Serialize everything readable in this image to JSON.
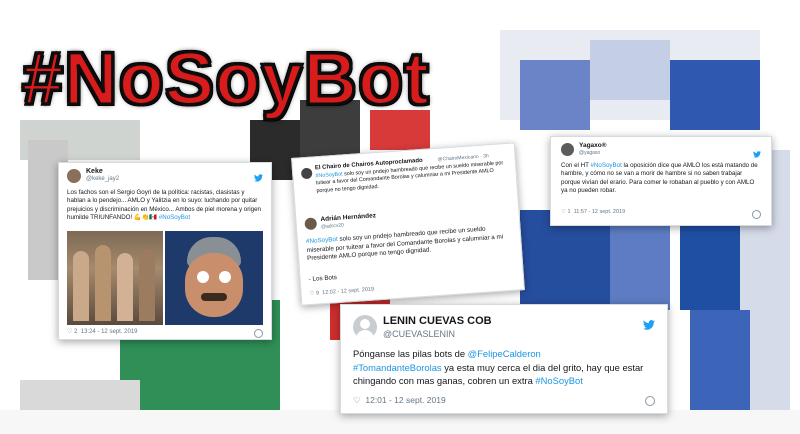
{
  "headline": "#NoSoyBot",
  "tweet1": {
    "name": "Keke",
    "handle": "@keke_jay2",
    "body": "Los fachos son el Sergio Goyri de la política: racistas, clasistas y hablan a lo pendejo... AMLO y Yalitzia en lo suyo: luchando por quitar prejuicios y discriminación en México... Ambos de piel morena y origen humilde TRIUNFANDO! 💪👏🇲🇽",
    "hashtag": "#NoSoyBot",
    "replies": "2",
    "time": "13:24 - 12 sept. 2019"
  },
  "tweet2": {
    "name": "El Chairo de Chairos Autoproclamado",
    "handle": "@ChairoMexicano · 3h",
    "quoted_hashtag": "#NoSoyBot",
    "quoted_body": "solo soy un pndejo hambreado que recibe un sueldo miserable por tuitear a favor del Comandante Borolas y calumniar a mi Presidente AMLO porque no tengo dignidad.",
    "reply_name": "Adrián Hernández",
    "reply_handle": "@adrcv20",
    "body_hashtag": "#NoSoyBot",
    "body": "solo soy un pndejo hambreado que recibe un sueldo miserable por tuitear  a favor del Comandante Borolas y calumniar a mi Presidente AMLO porque  no tengo dignidad.",
    "signoff": "- Los Bots",
    "replies": "9",
    "time": "12:02 - 12 sept. 2019"
  },
  "tweet3": {
    "name": "Yagaxo®",
    "handle": "@yagaxo",
    "body_pre": "Con el HT",
    "hashtag": "#NoSoyBot",
    "body_post": "la oposición dice que AMLO los está matando de hambre, y cómo no se van a morir de hambre si no saben trabajar porque vivían del erario. Para comer le robaban al pueblo y con AMLO ya no pueden robar.",
    "replies": "1",
    "time": "11:57 - 12 sept. 2019"
  },
  "tweet4": {
    "name": "LENIN CUEVAS COB",
    "handle": "@CUEVASLENIN",
    "body_pre": "Pónganse las pilas bots de",
    "mention": "@FelipeCalderon",
    "hashtag_inline": "#TomandanteBorolas",
    "body_mid": "ya esta muy cerca el dia del grito, hay que estar chingando con mas ganas, cobren un extra",
    "hashtag_end": "#NoSoyBot",
    "time": "12:01 - 12 sept. 2019"
  },
  "colors": {
    "headline_red": "#d81b1b",
    "twitter_blue": "#1da1f2",
    "flag_green": "#2e8b57",
    "flag_red": "#c62828",
    "pan_blue": "#1f4fa3"
  }
}
